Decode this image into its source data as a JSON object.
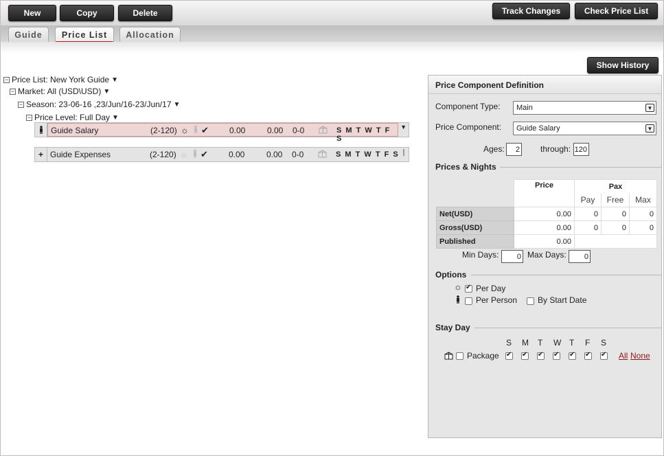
{
  "toolbar": {
    "new_label": "New",
    "copy_label": "Copy",
    "delete_label": "Delete",
    "track_changes_label": "Track Changes",
    "check_price_list_label": "Check Price List"
  },
  "tabs": [
    {
      "label": "Guide",
      "active": false
    },
    {
      "label": "Price List",
      "active": true
    },
    {
      "label": "Allocation",
      "active": false
    }
  ],
  "show_history_label": "Show History",
  "tree": {
    "price_list": "Price List: New York Guide",
    "market": "Market: All (USD\\USD)",
    "season": "Season: 23-06-16 ,23/Jun/16-23/Jun/17",
    "price_level": "Price Level: Full Day"
  },
  "components": [
    {
      "name": "Guide Salary",
      "ages": "(2-120)",
      "net": "0.00",
      "gross": "0.00",
      "pax": "0-0",
      "days": "S M T W T F S",
      "selected": true,
      "lead": "person-icon"
    },
    {
      "name": "Guide Expenses",
      "ages": "(2-120)",
      "net": "0.00",
      "gross": "0.00",
      "pax": "0-0",
      "days": "S M T W T F S",
      "selected": false,
      "lead": "+"
    }
  ],
  "panel": {
    "title": "Price Component Definition",
    "component_type_label": "Component Type:",
    "component_type_value": "Main",
    "price_component_label": "Price Component:",
    "price_component_value": "Guide Salary",
    "ages_label": "Ages:",
    "ages_from": "2",
    "through_label": "through:",
    "ages_to": "120",
    "prices_nights_title": "Prices & Nights",
    "table": {
      "price_header": "Price",
      "pax_header": "Pax",
      "pay_header": "Pay",
      "free_header": "Free",
      "max_header": "Max",
      "rows": [
        {
          "label": "Net(USD)",
          "price": "0.00",
          "pay": "0",
          "free": "0",
          "max": "0"
        },
        {
          "label": "Gross(USD)",
          "price": "0.00",
          "pay": "0",
          "free": "0",
          "max": "0"
        },
        {
          "label": "Published",
          "price": "0.00"
        }
      ]
    },
    "min_days_label": "Min Days:",
    "min_days": "0",
    "max_days_label": "Max Days:",
    "max_days": "0",
    "options_title": "Options",
    "per_day_label": "Per Day",
    "per_day_checked": true,
    "per_person_label": "Per Person",
    "per_person_checked": false,
    "by_start_date_label": "By Start Date",
    "by_start_date_checked": false,
    "stay_day_title": "Stay Day",
    "day_letters": [
      "S",
      "M",
      "T",
      "W",
      "T",
      "F",
      "S"
    ],
    "day_checked": [
      true,
      true,
      true,
      true,
      true,
      true,
      true
    ],
    "package_label": "Package",
    "package_checked": false,
    "all_label": "All",
    "none_label": "None"
  }
}
